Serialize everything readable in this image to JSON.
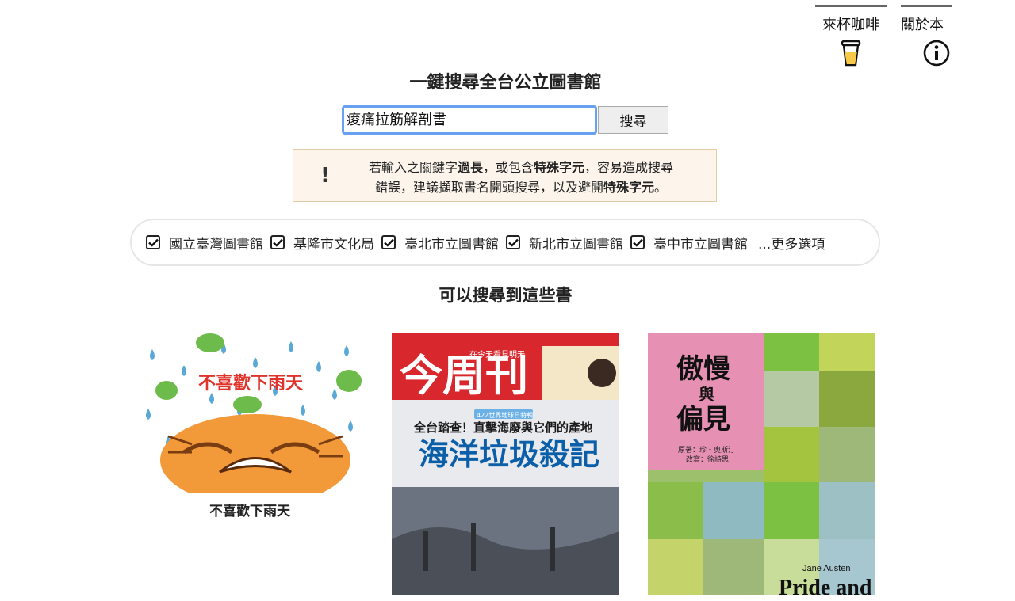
{
  "nav": {
    "coffee_label": "來杯咖啡",
    "about_label": "關於本",
    "coffee_icon": "coffee-cup-icon",
    "about_icon": "info-icon"
  },
  "page_title": "一鍵搜尋全台公立圖書館",
  "search": {
    "value": "痠痛拉筋解剖書",
    "button_label": "搜尋"
  },
  "notice": {
    "icon": "exclamation-icon",
    "line1_a": "若輸入之關鍵字",
    "line1_b": "過長",
    "line1_c": "，或包含",
    "line1_d": "特殊字元",
    "line1_e": "，容易造成搜尋",
    "line2_a": "錯誤，建議擷取書名開頭搜尋，以及避開",
    "line2_b": "特殊字元",
    "line2_c": "。"
  },
  "libraries": [
    {
      "label": "國立臺灣圖書館",
      "checked": true
    },
    {
      "label": "基隆市文化局",
      "checked": true
    },
    {
      "label": "臺北市立圖書館",
      "checked": true
    },
    {
      "label": "新北市立圖書館",
      "checked": true
    },
    {
      "label": "臺中市立圖書館",
      "checked": true
    }
  ],
  "more_options": "...更多選項",
  "results_title": "可以搜尋到這些書",
  "books": [
    {
      "title": "不喜歡下雨天",
      "cover_text": "不喜歡下雨天"
    },
    {
      "title": "",
      "cover_masthead": "今周刊",
      "cover_tagline": "在今天看見明天",
      "cover_kicker": "全台踏查！直擊海廢與它們的產地",
      "cover_headline": "海洋垃圾殺記",
      "cover_badge": "422世界地球日特輯"
    },
    {
      "title": "",
      "cover_title_1": "傲慢",
      "cover_title_2": "與",
      "cover_title_3": "偏見",
      "cover_author": "原著：珍・奧斯汀",
      "cover_adapter": "改寫：徐詩思",
      "cover_en_author": "Jane Austen",
      "cover_en_title": "Pride and"
    }
  ]
}
